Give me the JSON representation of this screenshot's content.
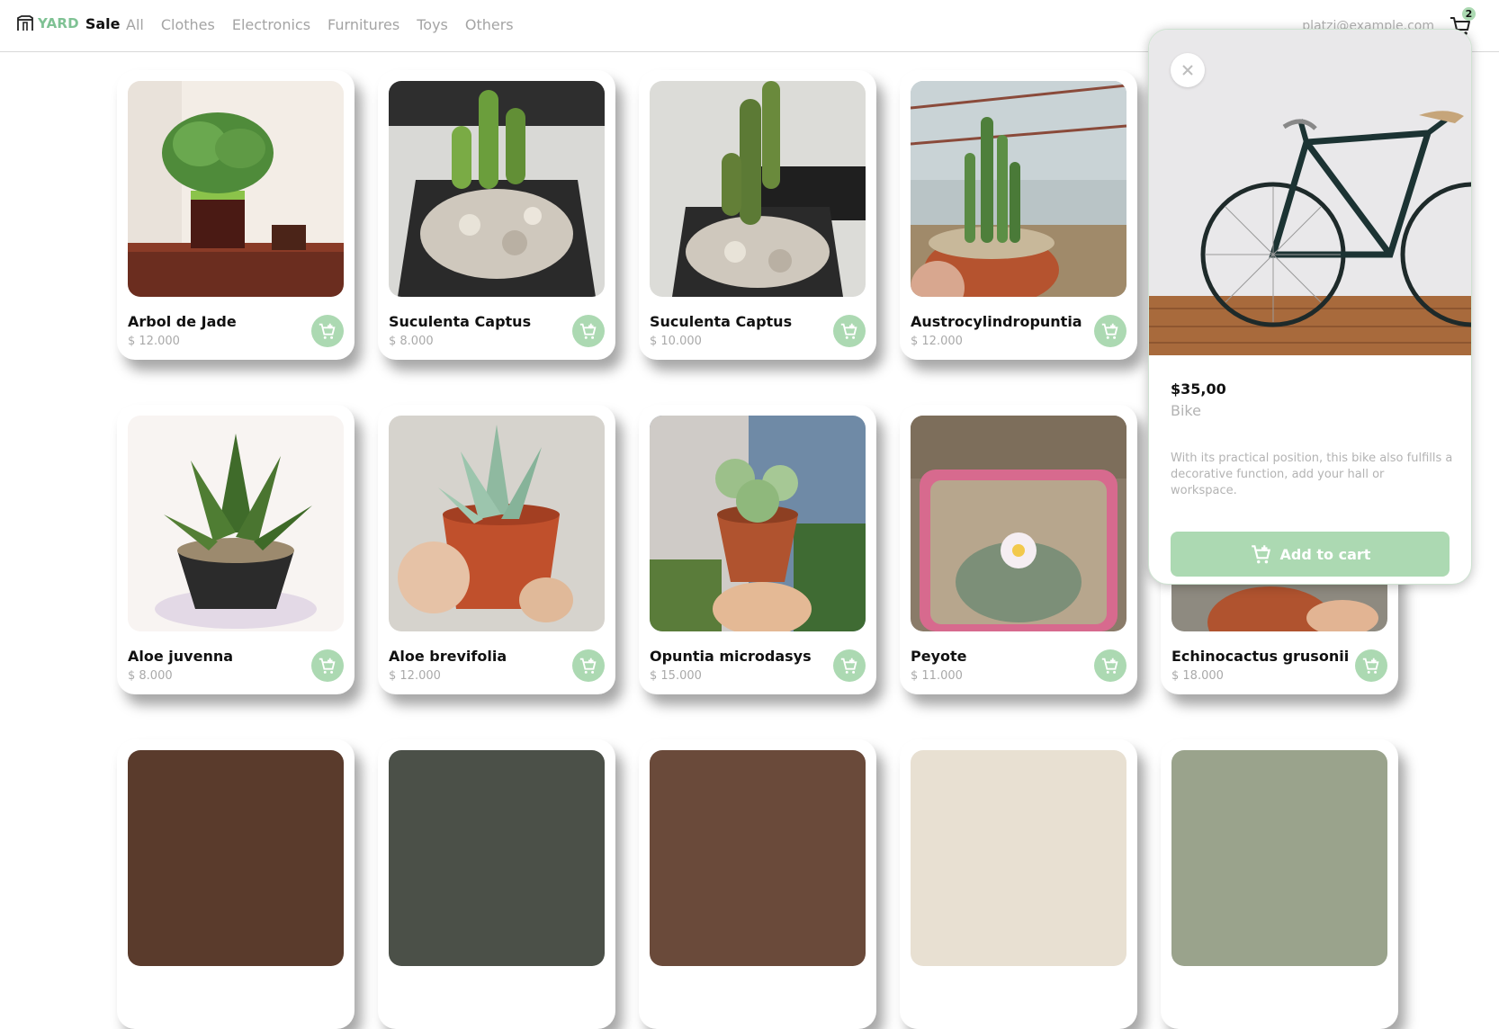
{
  "brand": {
    "yard": "YARD",
    "sale": "Sale"
  },
  "nav": [
    "All",
    "Clothes",
    "Electronics",
    "Furnitures",
    "Toys",
    "Others"
  ],
  "user": {
    "email": "platzi@example.com"
  },
  "cart": {
    "count": "2"
  },
  "products": [
    {
      "name": "Arbol de Jade",
      "price": "$ 12.000"
    },
    {
      "name": "Suculenta Captus",
      "price": "$ 8.000"
    },
    {
      "name": "Suculenta Captus",
      "price": "$ 10.000"
    },
    {
      "name": "Austrocylindropuntia",
      "price": "$ 12.000"
    },
    {
      "name": "Aloe juvenna",
      "price": "$ 8.000"
    },
    {
      "name": "Aloe brevifolia",
      "price": "$ 12.000"
    },
    {
      "name": "Opuntia microdasys",
      "price": "$ 15.000"
    },
    {
      "name": "Peyote",
      "price": "$ 11.000"
    },
    {
      "name": "Echinocactus grusonii",
      "price": "$ 18.000"
    }
  ],
  "detail": {
    "price": "$35,00",
    "name": "Bike",
    "description": "With its practical position, this bike also fulfills a decorative function, add your hall or workspace.",
    "button_label": "Add to cart"
  },
  "colors": {
    "accent": "#acd9b2",
    "brand_green": "#7fc294",
    "muted_text": "#a9a9a9"
  }
}
